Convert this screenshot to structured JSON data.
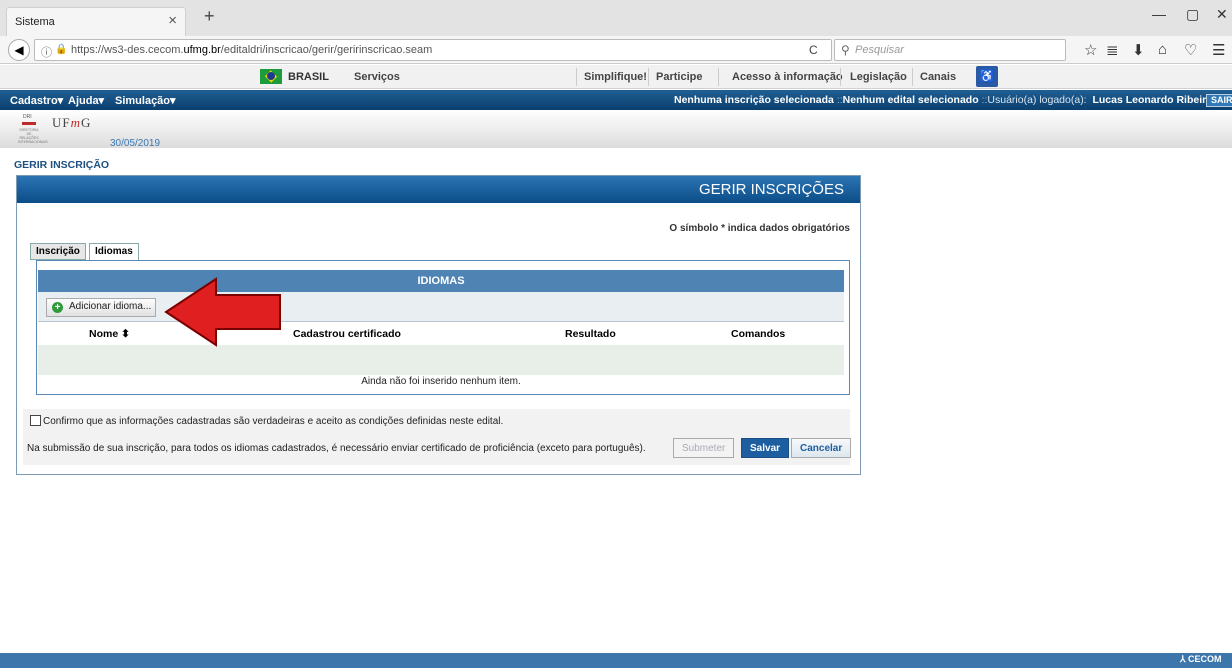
{
  "browser": {
    "tab_title": "Sistema",
    "url_prefix": "https://ws3-des.cecom.",
    "url_domain": "ufmg.br",
    "url_path": "/editaldri/inscricao/gerir/geririnscricao.seam",
    "search_placeholder": "Pesquisar"
  },
  "govbar": {
    "brasil": "BRASIL",
    "links": [
      "Serviços",
      "Simplifique!",
      "Participe",
      "Acesso à informação",
      "Legislação",
      "Canais"
    ]
  },
  "menu": {
    "items": [
      "Cadastro▾",
      "Ajuda▾",
      "Simulação▾"
    ],
    "status_inscricao": "Nenhuma inscrição selecionada",
    "status_edital": "Nenhum edital selecionado",
    "user_label": "Usuário(a) logado(a):",
    "user_name": "Lucas Leonardo Ribeiro Pacheco",
    "logout": "SAIR"
  },
  "header": {
    "ufmg": "UFMG",
    "date": "30/05/2019"
  },
  "page": {
    "label": "GERIR INSCRIÇÃO",
    "panel_title": "GERIR INSCRIÇÕES",
    "required_note": "O símbolo * indica dados obrigatórios",
    "tabs": [
      "Inscrição",
      "Idiomas"
    ],
    "section_title": "IDIOMAS",
    "add_button": "Adicionar idioma...",
    "columns": [
      "Nome ⬍",
      "Cadastrou certificado",
      "Resultado",
      "Comandos"
    ],
    "empty_message": "Ainda não foi inserido nenhum item.",
    "confirm_text": "Confirmo que as informações cadastradas são verdadeiras e aceito as condições definidas neste edital.",
    "proficiency_text": "Na submissão de sua inscrição, para todos os idiomas cadastrados, é necessário enviar certificado de proficiência (exceto para português).",
    "btn_submit": "Submeter",
    "btn_save": "Salvar",
    "btn_cancel": "Cancelar"
  },
  "footer": {
    "brand": "CECOM"
  },
  "colors": {
    "brand_blue": "#0b4d88",
    "save_blue": "#1d5ea0",
    "arrow_red": "#e02020"
  }
}
